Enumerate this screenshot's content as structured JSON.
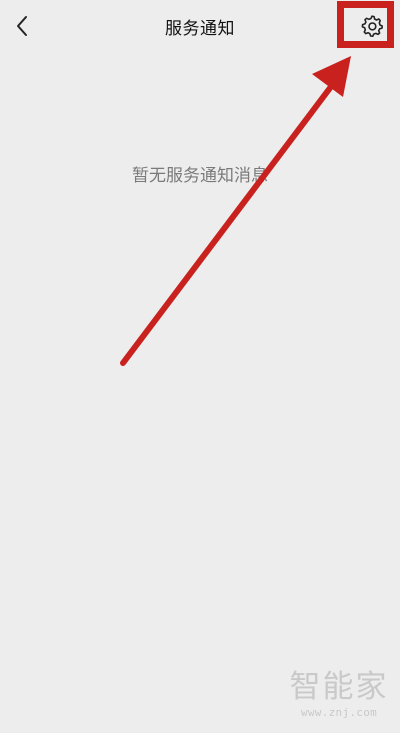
{
  "header": {
    "title": "服务通知",
    "back_icon": "chevron-left-icon",
    "settings_icon": "gear-icon"
  },
  "main": {
    "empty_text": "暂无服务通知消息"
  },
  "annotation": {
    "color": "#c9211e"
  },
  "watermark": {
    "logo": "智能家",
    "url": "www.znj.com"
  }
}
